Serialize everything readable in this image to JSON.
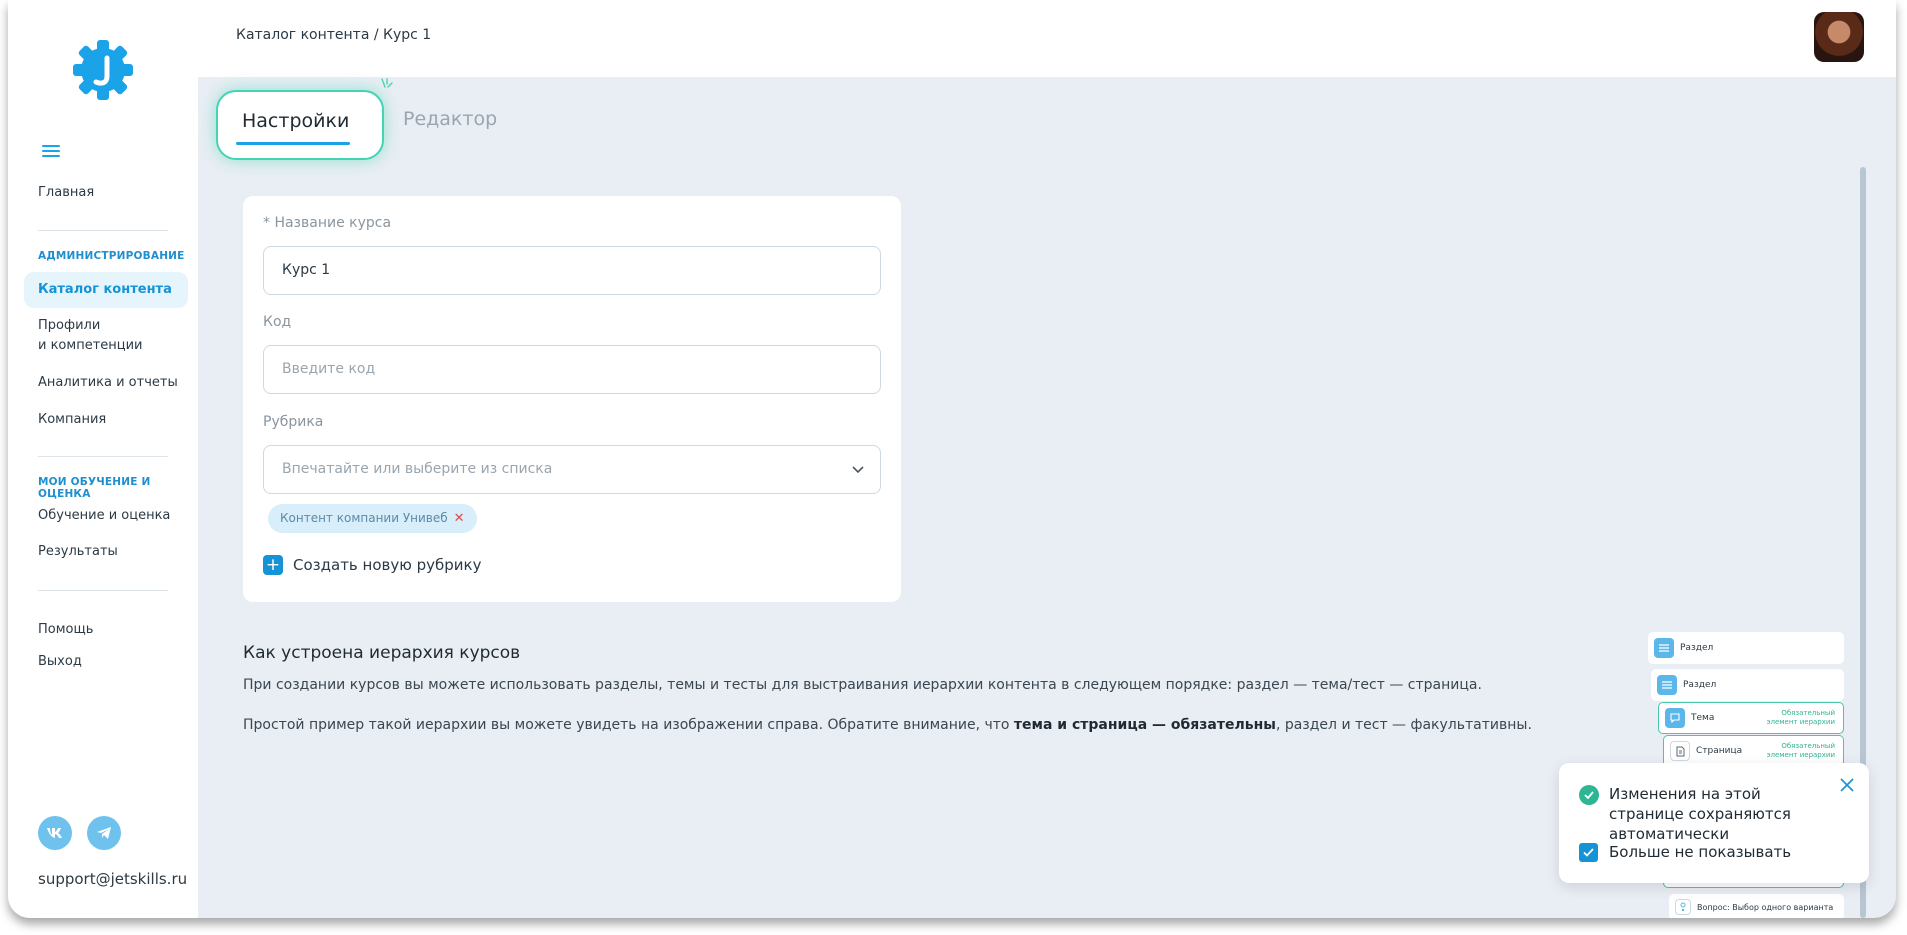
{
  "header": {
    "breadcrumb": "Каталог контента / Курс 1"
  },
  "sidebar": {
    "main": "Главная",
    "admin_heading": "АДМИНИСТРИРОВАНИЕ",
    "catalog": "Каталог контента",
    "profiles_line1": "Профили",
    "profiles_line2": "и компетенции",
    "analytics": "Аналитика и отчеты",
    "company": "Компания",
    "learning_heading": "МОИ ОБУЧЕНИЕ И ОЦЕНКА",
    "learning": "Обучение и оценка",
    "results": "Результаты",
    "help": "Помощь",
    "logout": "Выход",
    "support_email": "support@jetskills.ru"
  },
  "tabs": {
    "settings": "Настройки",
    "editor": "Редактор"
  },
  "form": {
    "name_label": "* Название курса",
    "name_value": "Курс 1",
    "code_label": "Код",
    "code_placeholder": "Введите код",
    "rubric_label": "Рубрика",
    "rubric_placeholder": "Впечатайте или выберите из списка",
    "chip": "Контент компании Унивеб",
    "create_rubric": "Создать новую рубрику"
  },
  "info": {
    "title": "Как устроена иерархия курсов",
    "p1": "При создании курсов вы можете использовать разделы, темы и тесты для выстраивания иерархии контента в следующем порядке: раздел — тема/тест — страница.",
    "p2_before": "Простой пример такой иерархии вы можете увидеть на изображении справа. Обратите внимание, что ",
    "p2_bold": "тема и страница — обязательны",
    "p2_after": ", раздел и тест — факультативны."
  },
  "hierarchy": {
    "section": "Раздел",
    "topic": "Тема",
    "page": "Страница",
    "required_line1": "Обязательный",
    "required_line2": "элемент иерархии",
    "question": "Вопрос: Выбор одного варианта"
  },
  "toast": {
    "message": "Изменения на этой странице сохраняются автоматически",
    "dont_show": "Больше не показывать"
  },
  "colors": {
    "accent": "#1494d6",
    "accent_light": "#e6f4fc",
    "success": "#2eb592",
    "tab_glow": "#46d3b3",
    "page_bg": "#e9eef4"
  }
}
